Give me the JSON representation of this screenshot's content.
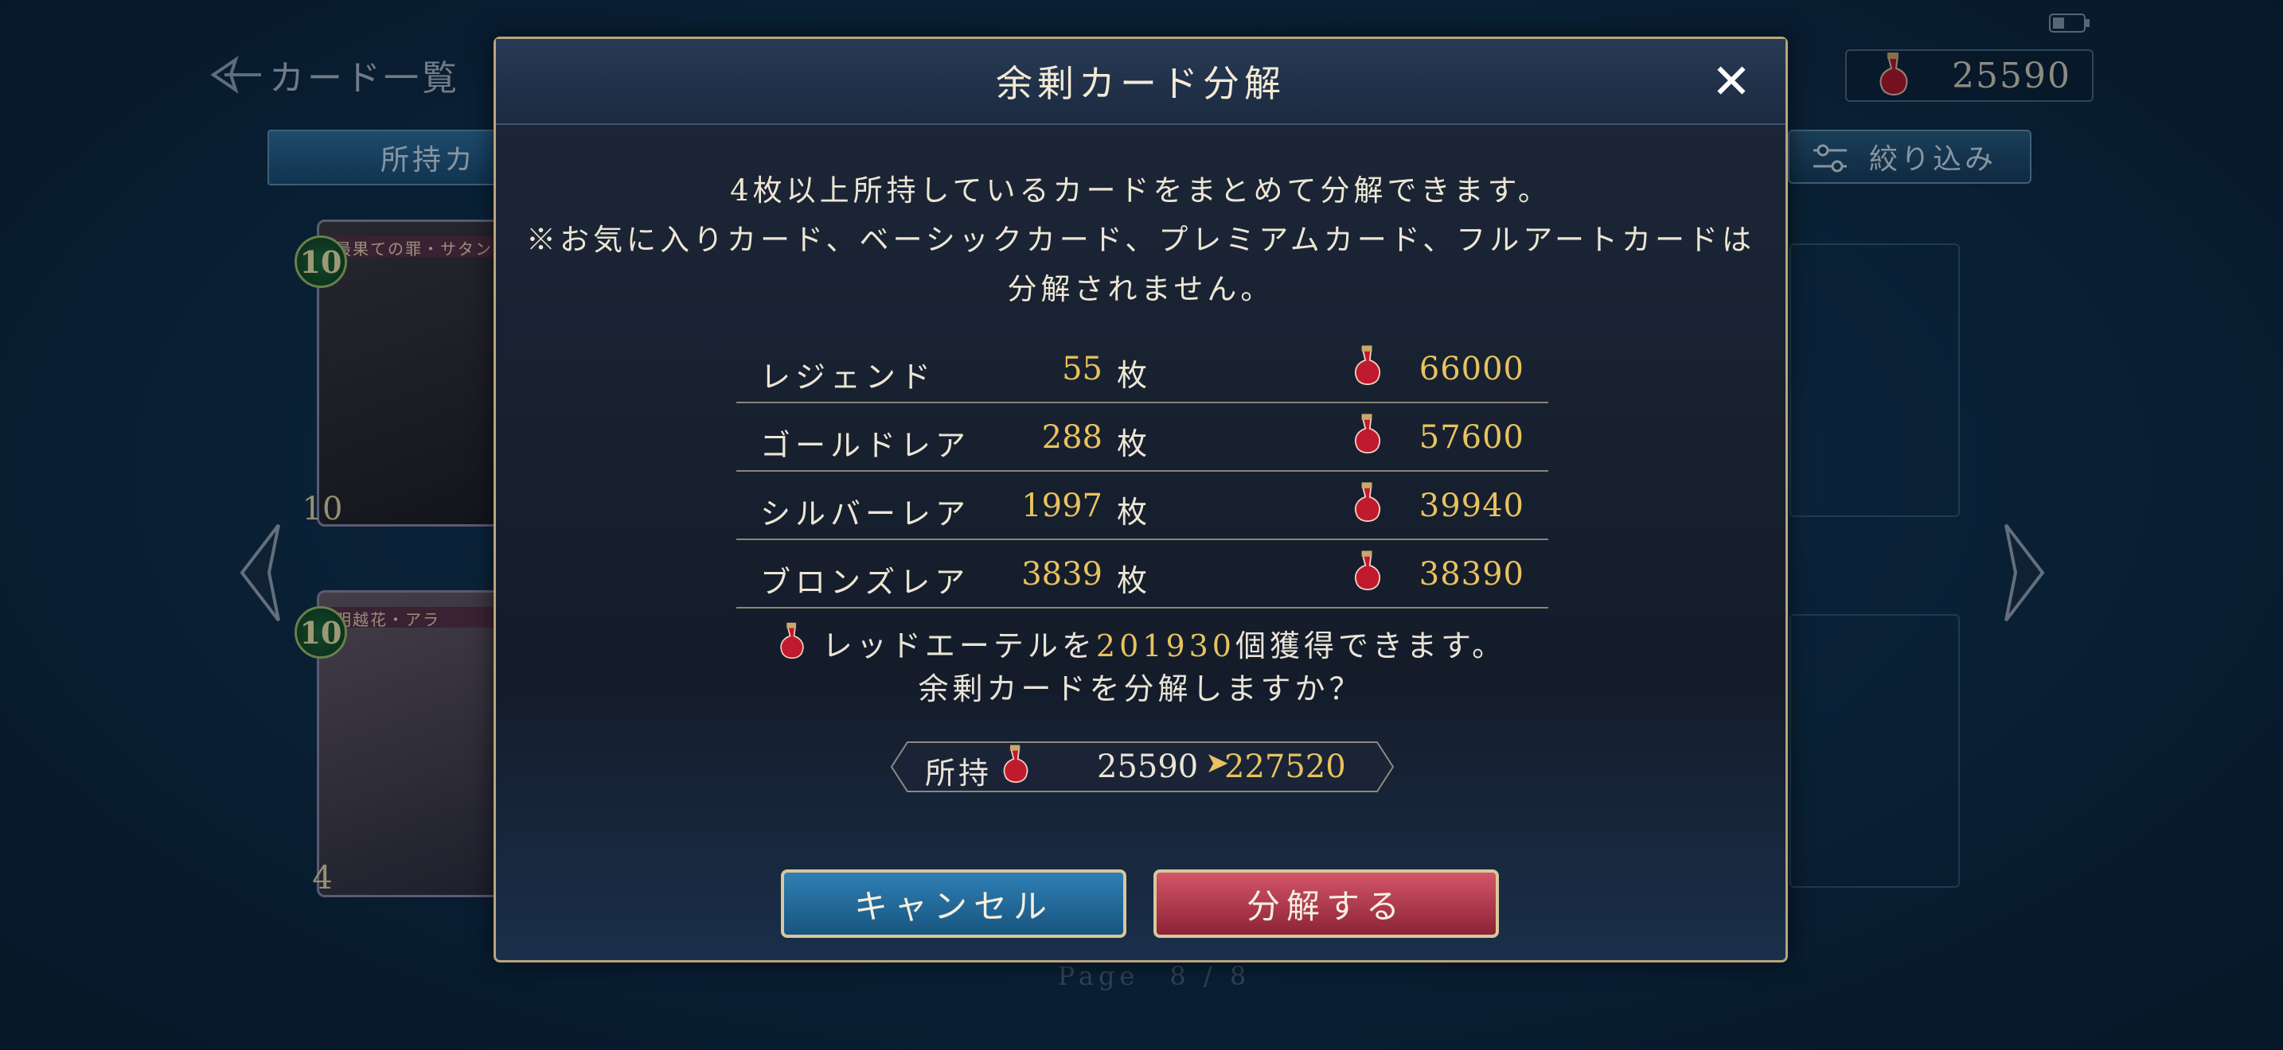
{
  "background": {
    "back_title": "カード一覧",
    "tab_owned": "所持カ",
    "currency_value": "25590",
    "filter_label": "絞り込み",
    "cards": [
      {
        "cost": "10",
        "name": "最果ての罪・サタン",
        "count": "10"
      },
      {
        "cost": "10",
        "name": "明越花・アラ",
        "count": "4"
      }
    ],
    "page_indicator": "Page　8 / 8"
  },
  "modal": {
    "title": "余剰カード分解",
    "close_symbol": "✕",
    "desc_line1": "4枚以上所持しているカードをまとめて分解できます。",
    "desc_line2": "※お気に入りカード、ベーシックカード、プレミアムカード、フルアートカードは",
    "desc_line3": "分解されません。",
    "unit": "枚",
    "rows": [
      {
        "name": "レジェンド",
        "count": "55",
        "value": "66000"
      },
      {
        "name": "ゴールドレア",
        "count": "288",
        "value": "57600"
      },
      {
        "name": "シルバーレア",
        "count": "1997",
        "value": "39940"
      },
      {
        "name": "ブロンズレア",
        "count": "3839",
        "value": "38390"
      }
    ],
    "gain_prefix": "レッドエーテルを",
    "gain_amount": "201930",
    "gain_suffix": "個獲得できます。",
    "confirm_text": "余剰カードを分解しますか？",
    "owned_label": "所持",
    "owned_current": "25590",
    "owned_after": "227520",
    "cancel_label": "キャンセル",
    "confirm_label": "分解する"
  },
  "colors": {
    "accent_gold": "#e8c25e",
    "cancel_blue": "#2f7fb4",
    "confirm_red": "#d45569",
    "frame": "#b8a57a"
  },
  "icons": [
    "back-arrow-icon",
    "red-ether-icon",
    "filter-icon",
    "battery-icon",
    "close-icon",
    "nav-left-icon",
    "nav-right-icon"
  ]
}
